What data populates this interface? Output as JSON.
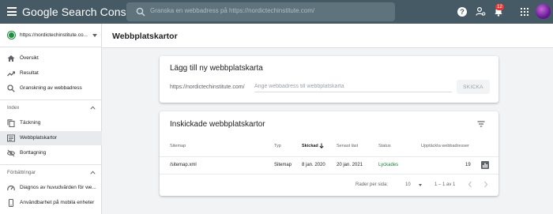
{
  "app": {
    "name": "Google Search Console",
    "search_placeholder": "Granska en webbadress på https://nordictechinstitute.com/",
    "notification_count": "12"
  },
  "sidebar": {
    "property": "https://nordictechinstitute.co...",
    "top_items": [
      {
        "label": "Översikt",
        "icon": "home-icon"
      },
      {
        "label": "Resultat",
        "icon": "trending-up-icon"
      },
      {
        "label": "Granskning av webbadress",
        "icon": "search-icon"
      }
    ],
    "sections": [
      {
        "label": "Index",
        "items": [
          {
            "label": "Täckning",
            "icon": "copy-icon"
          },
          {
            "label": "Webbplatskartor",
            "icon": "sitemap-icon",
            "active": true
          },
          {
            "label": "Borttagning",
            "icon": "visibility-off-icon"
          }
        ]
      },
      {
        "label": "Förbättringar",
        "items": [
          {
            "label": "Diagnos av huvudvärden för we...",
            "icon": "speed-icon"
          },
          {
            "label": "Användbarhet på mobila enheter",
            "icon": "phone-icon"
          }
        ]
      }
    ]
  },
  "page": {
    "title": "Webbplatskartor"
  },
  "add_card": {
    "title": "Lägg till ny webbplatskarta",
    "prefix": "https://nordictechinstitute.com/",
    "placeholder": "Ange webbadress till webbplatskarta",
    "submit": "SKICKA"
  },
  "submitted_card": {
    "title": "Inskickade webbplatskartor",
    "columns": {
      "sitemap": "Sitemap",
      "type": "Typ",
      "submitted": "Skickad",
      "last_read": "Senast läst",
      "status": "Status",
      "discovered": "Upptäckta webbadresser"
    },
    "rows": [
      {
        "sitemap": "/sitemap.xml",
        "type": "Sitemap",
        "submitted": "8 jan. 2020",
        "last_read": "20 jan. 2021",
        "status": "Lyckades",
        "discovered": "19"
      }
    ],
    "pagination": {
      "rows_per_page_label": "Rader per sida:",
      "rows_per_page": "10",
      "range": "1 – 1 av 1"
    }
  },
  "colors": {
    "topbar": "#455a64",
    "success": "#188038",
    "property_dot": "#1e8e3e",
    "badge": "#e53935"
  }
}
